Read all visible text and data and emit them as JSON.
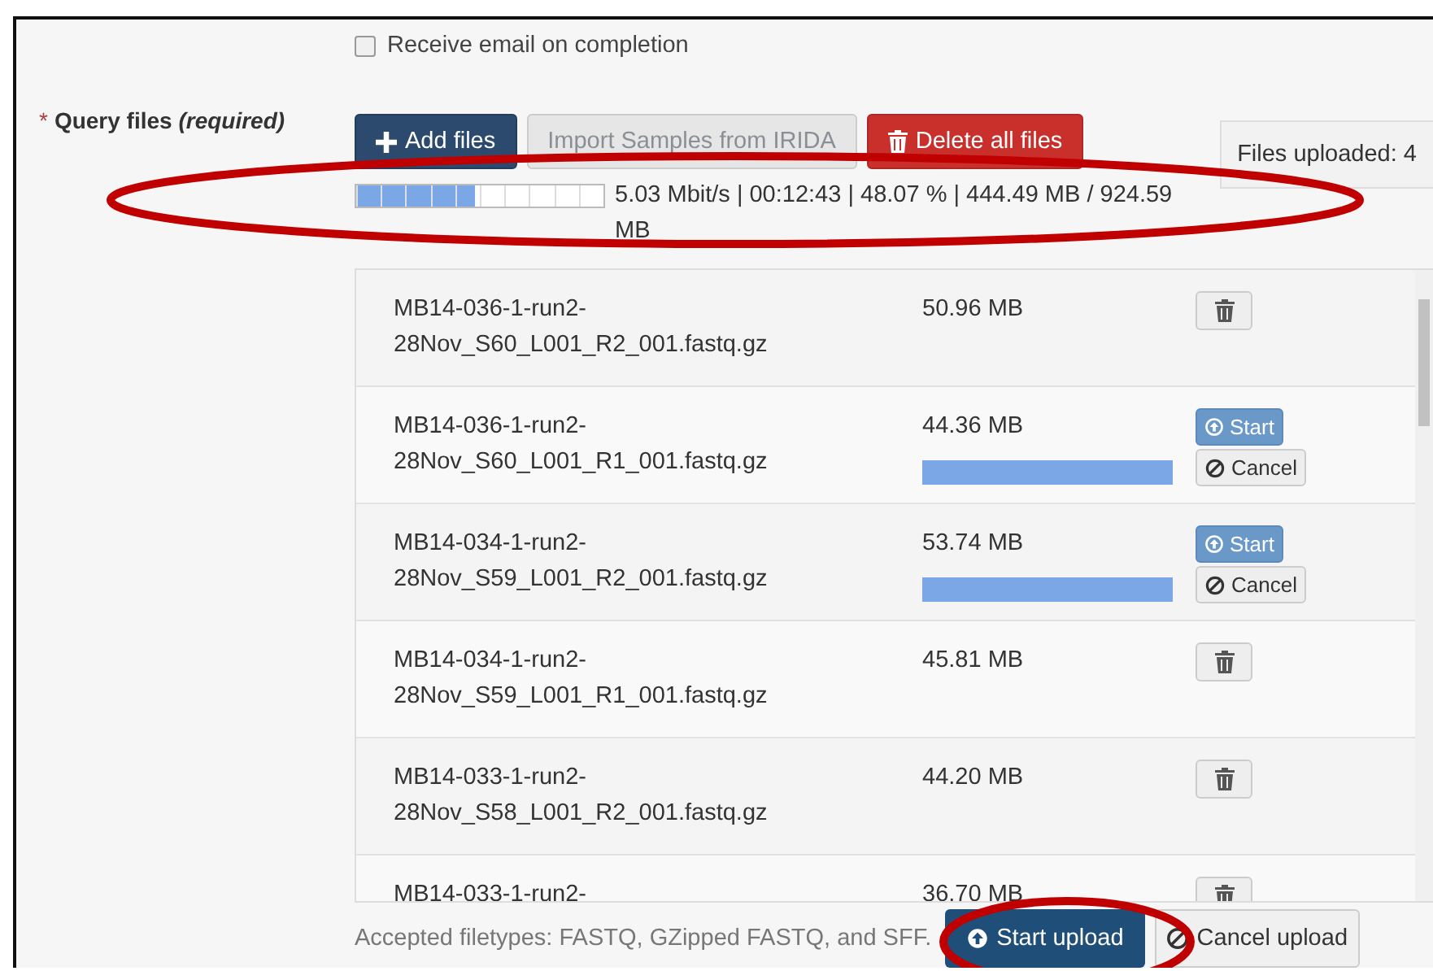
{
  "email_option": {
    "label": "Receive email on completion",
    "checked": false
  },
  "query_files": {
    "required_mark": "*",
    "label": "Query files *(required)*"
  },
  "buttons": {
    "add": "Add files",
    "import": "Import Samples from IRIDA",
    "delete_all": "Delete all files"
  },
  "files_uploaded": "Files uploaded: 4",
  "overall_progress": {
    "level": 0.48,
    "reading": "5.03 Mbit/s | 00:12:43 | 48.07 % | 444.49 MB / 924.59 MB"
  },
  "files": [
    {
      "name": "MB14-036-1-run2-28Nov_S60_L001_R2_001.fastq.gz",
      "size": "50.96 MB",
      "kind": "uploaded"
    },
    {
      "name": "MB14-036-1-run2-28Nov_S60_L001_R1_001.fastq.gz",
      "size": "44.36 MB",
      "kind": "queued",
      "level": 1,
      "start": "Start",
      "cancel": "Cancel"
    },
    {
      "name": "MB14-034-1-run2-28Nov_S59_L001_R2_001.fastq.gz",
      "size": "53.74 MB",
      "kind": "queued",
      "level": 1,
      "start": "Start",
      "cancel": "Cancel"
    },
    {
      "name": "MB14-034-1-run2-28Nov_S59_L001_R1_001.fastq.gz",
      "size": "45.81 MB",
      "kind": "uploaded"
    },
    {
      "name": "MB14-033-1-run2-28Nov_S58_L001_R2_001.fastq.gz",
      "size": "44.20 MB",
      "kind": "uploaded"
    },
    {
      "name": "MB14-033-1-run2-",
      "size": "36.70 MB",
      "kind": "uploaded"
    }
  ],
  "accepted_filetypes": "Accepted filetypes: FASTQ, GZipped FASTQ, and SFF.",
  "start_upload": "Start upload",
  "cancel_upload": "Cancel upload"
}
